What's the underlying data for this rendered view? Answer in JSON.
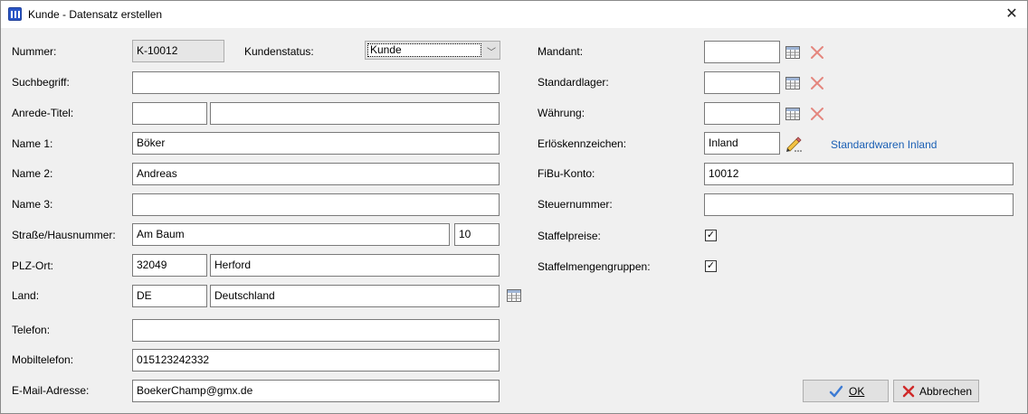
{
  "window": {
    "title": "Kunde - Datensatz erstellen"
  },
  "labels": {
    "nummer": "Nummer:",
    "kundenstatus": "Kundenstatus:",
    "suchbegriff": "Suchbegriff:",
    "anrede_titel": "Anrede-Titel:",
    "name1": "Name 1:",
    "name2": "Name 2:",
    "name3": "Name 3:",
    "strasse": "Straße/Hausnummer:",
    "plz_ort": "PLZ-Ort:",
    "land": "Land:",
    "telefon": "Telefon:",
    "mobiltelefon": "Mobiltelefon:",
    "email": "E-Mail-Adresse:",
    "mandant": "Mandant:",
    "standardlager": "Standardlager:",
    "waehrung": "Währung:",
    "erloeskennzeichen": "Erlöskennzeichen:",
    "fibu_konto": "FiBu-Konto:",
    "steuernummer": "Steuernummer:",
    "staffelpreise": "Staffelpreise:",
    "staffelmengengruppen": "Staffelmengengruppen:"
  },
  "fields": {
    "nummer": "K-10012",
    "kundenstatus": "Kunde",
    "suchbegriff": "",
    "anrede": "",
    "titel": "",
    "name1": "Böker",
    "name2": "Andreas",
    "name3": "",
    "strasse": "Am Baum",
    "hausnummer": "10",
    "plz": "32049",
    "ort": "Herford",
    "land_code": "DE",
    "land_name": "Deutschland",
    "telefon": "",
    "mobiltelefon": "015123242332",
    "email": "BoekerChamp@gmx.de",
    "mandant": "",
    "standardlager": "",
    "waehrung": "",
    "erloeskennzeichen": "Inland",
    "fibu_konto": "10012",
    "steuernummer": ""
  },
  "checkboxes": {
    "staffelpreise": true,
    "staffelmengengruppen": true
  },
  "links": {
    "standardwaren": "Standardwaren Inland"
  },
  "buttons": {
    "ok": "OK",
    "abbrechen": "Abbrechen"
  },
  "colors": {
    "accent": "#2a56c6",
    "link": "#1a5fb4",
    "clear": "#e05a4f",
    "check": "#3d7bd4",
    "cancel": "#d02a2a"
  },
  "icons": {
    "app": "window-app-icon",
    "lookup": "table-grid-icon",
    "clear": "x-mark-icon",
    "edit": "pencil-icon",
    "ok": "checkmark-icon",
    "cancel": "red-x-icon"
  }
}
